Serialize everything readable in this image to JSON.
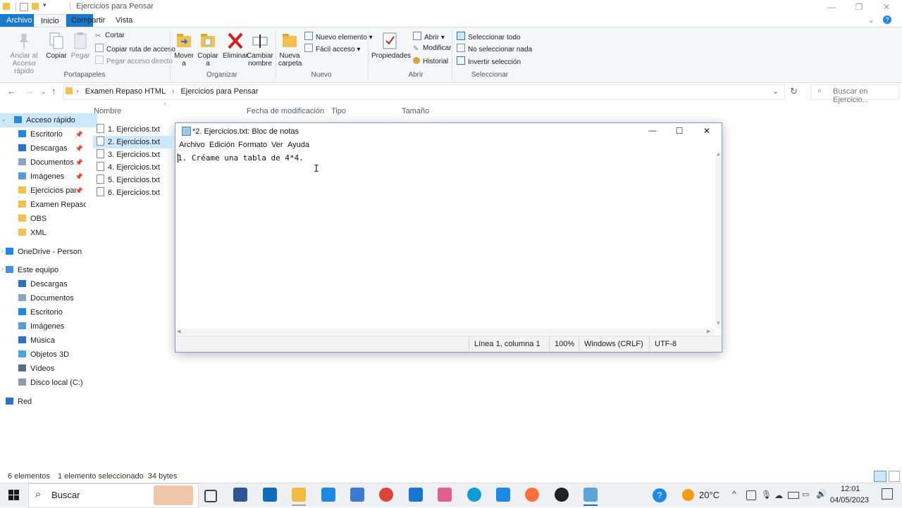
{
  "explorer": {
    "title": "Ejercicios para Pensar",
    "tabs": [
      "Archivo",
      "Inicio",
      "Compartir",
      "Vista"
    ],
    "ribbon": {
      "portapapeles": {
        "pin": "Anclar al Acceso rápido",
        "copy": "Copiar",
        "paste": "Pegar",
        "cut": "Cortar",
        "copy_path": "Copiar ruta de acceso",
        "paste_shortcut": "Pegar acceso directo",
        "label": "Portapapeles"
      },
      "organizar": {
        "move": "Mover a",
        "copy_to": "Copiar a",
        "delete": "Eliminar",
        "rename": "Cambiar nombre",
        "label": "Organizar"
      },
      "nuevo": {
        "new_folder": "Nueva carpeta",
        "new_item": "Nuevo elemento",
        "easy_access": "Fácil acceso",
        "label": "Nuevo"
      },
      "abrir": {
        "properties": "Propiedades",
        "open": "Abrir",
        "edit": "Modificar",
        "history": "Historial",
        "label": "Abrir"
      },
      "seleccionar": {
        "select_all": "Seleccionar todo",
        "select_none": "No seleccionar nada",
        "invert": "Invertir selección",
        "label": "Seleccionar"
      }
    },
    "breadcrumbs": [
      "Examen Repaso HTML",
      "Ejercicios para Pensar"
    ],
    "search_placeholder": "Buscar en Ejercicio...",
    "nav": [
      {
        "label": "Acceso rápido",
        "color": "#2b88d8",
        "pinned": false,
        "selected": true
      },
      {
        "label": "Escritorio",
        "color": "#1e88e5",
        "pinned": true
      },
      {
        "label": "Descargas",
        "color": "#2b73c7",
        "pinned": true
      },
      {
        "label": "Documentos",
        "color": "#8aa6c4",
        "pinned": true
      },
      {
        "label": "Imágenes",
        "color": "#5b9bd5",
        "pinned": true
      },
      {
        "label": "Ejercicios par",
        "color": "#f2c14e",
        "pinned": true
      },
      {
        "label": "Examen Repaso",
        "color": "#f2c14e",
        "pinned": false
      },
      {
        "label": "OBS",
        "color": "#f2c14e",
        "pinned": false
      },
      {
        "label": "XML",
        "color": "#f2c14e",
        "pinned": false
      },
      {
        "label": "OneDrive - Person",
        "color": "#1e88e5",
        "pinned": false
      },
      {
        "label": "Este equipo",
        "color": "#4a90d9",
        "pinned": false
      },
      {
        "label": "Descargas",
        "color": "#2b73c7",
        "pinned": false
      },
      {
        "label": "Documentos",
        "color": "#8aa6c4",
        "pinned": false
      },
      {
        "label": "Escritorio",
        "color": "#1e88e5",
        "pinned": false
      },
      {
        "label": "Imágenes",
        "color": "#5b9bd5",
        "pinned": false
      },
      {
        "label": "Música",
        "color": "#2b73c7",
        "pinned": false
      },
      {
        "label": "Objetos 3D",
        "color": "#4da3e0",
        "pinned": false
      },
      {
        "label": "Vídeos",
        "color": "#5a6d87",
        "pinned": false
      },
      {
        "label": "Disco local (C:)",
        "color": "#8c9bab",
        "pinned": false
      },
      {
        "label": "Red",
        "color": "#2b73c7",
        "pinned": false
      }
    ],
    "columns": [
      "Nombre",
      "Fecha de modificación",
      "Tipo",
      "Tamaño"
    ],
    "files": [
      {
        "name": "1. Ejercicios.txt"
      },
      {
        "name": "2. Ejercicios.txt",
        "selected": true
      },
      {
        "name": "3. Ejercicios.txt"
      },
      {
        "name": "4. Ejercicios.txt"
      },
      {
        "name": "5. Ejercicios.txt"
      },
      {
        "name": "6. Ejercicios.txt"
      }
    ],
    "status": {
      "count": "6 elementos",
      "selection": "1 elemento seleccionado  34 bytes"
    }
  },
  "notepad": {
    "title": "*2. Ejercicios.txt: Bloc de notas",
    "menu": [
      "Archivo",
      "Edición",
      "Formato",
      "Ver",
      "Ayuda"
    ],
    "content": "1. Créame una tabla de 4*4.",
    "status": {
      "position": "Línea 1, columna 1",
      "zoom": "100%",
      "line_endings": "Windows (CRLF)",
      "encoding": "UTF-8"
    }
  },
  "taskbar": {
    "search_label": "Buscar",
    "weather": "20°C",
    "time": "12:01",
    "date": "04/05/2023",
    "apps": [
      {
        "name": "task-view",
        "color": "#444444"
      },
      {
        "name": "powershell",
        "color": "#2b5797"
      },
      {
        "name": "outlook",
        "color": "#0f6cbd"
      },
      {
        "name": "file-explorer",
        "color": "#f4b942"
      },
      {
        "name": "mail",
        "color": "#1e88e5"
      },
      {
        "name": "calculator",
        "color": "#3a7bd5"
      },
      {
        "name": "chrome",
        "color": "#db4437"
      },
      {
        "name": "photos",
        "color": "#1976d2"
      },
      {
        "name": "paint",
        "color": "#e15f8a"
      },
      {
        "name": "edge",
        "color": "#0c9bd3"
      },
      {
        "name": "app-blue",
        "color": "#1e88e5"
      },
      {
        "name": "firefox",
        "color": "#ff7139"
      },
      {
        "name": "obs",
        "color": "#222222"
      },
      {
        "name": "notepad",
        "color": "#5ba5d9"
      }
    ]
  },
  "colors": {
    "accent": "#0078d4",
    "file_tab": "#1979ca",
    "selection": "#cce8ff"
  }
}
